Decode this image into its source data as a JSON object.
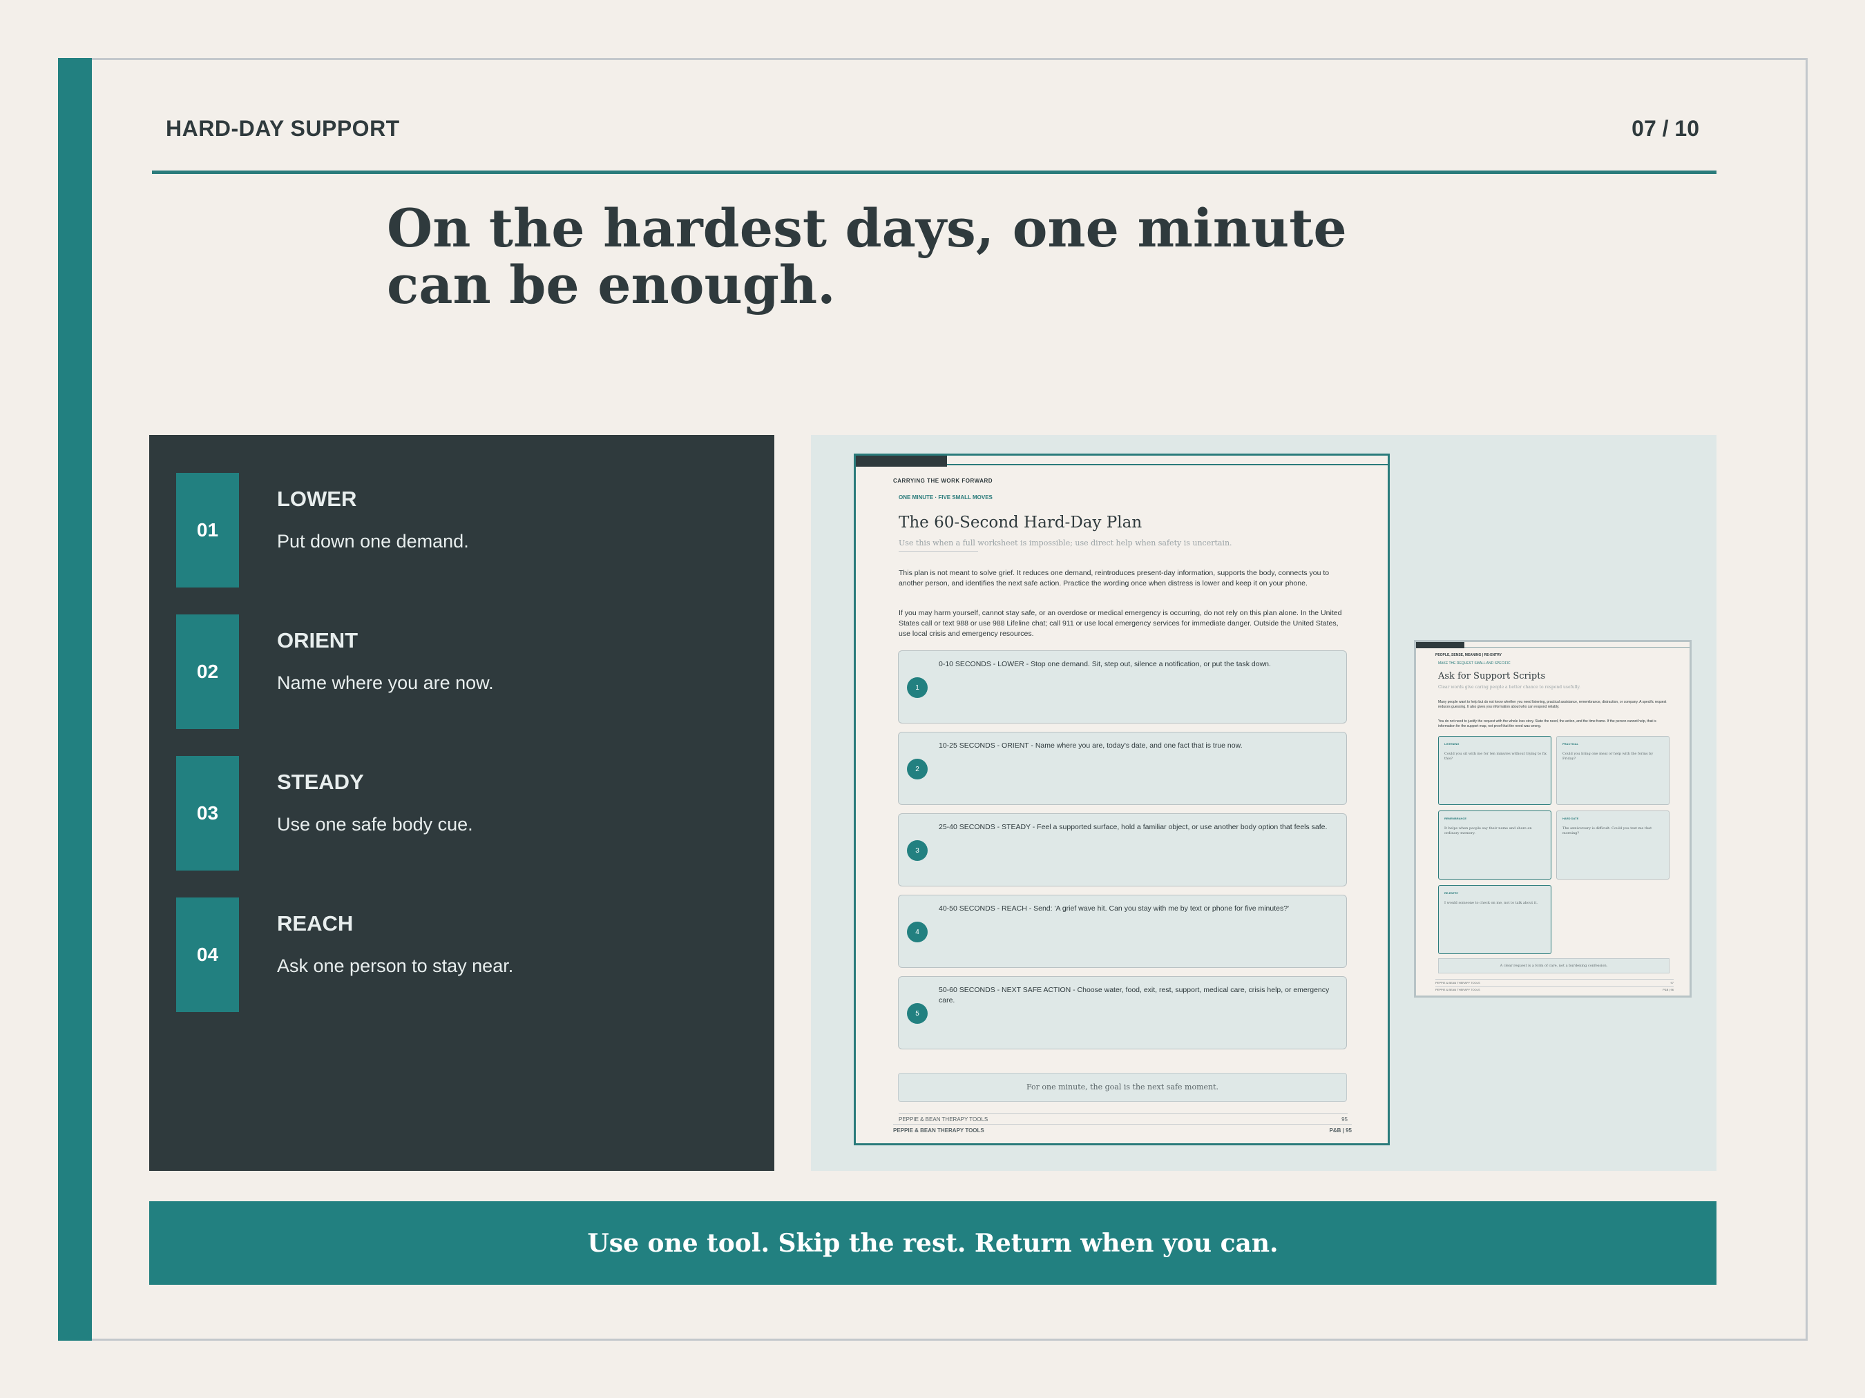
{
  "header": {
    "section": "HARD-DAY SUPPORT",
    "page": "07 / 10"
  },
  "headline": "On the hardest days, one minute can be enough.",
  "steps": [
    {
      "num": "01",
      "title": "LOWER",
      "desc": "Put down one demand."
    },
    {
      "num": "02",
      "title": "ORIENT",
      "desc": "Name where you are now."
    },
    {
      "num": "03",
      "title": "STEADY",
      "desc": "Use one safe body cue."
    },
    {
      "num": "04",
      "title": "REACH",
      "desc": "Ask one person to stay near."
    }
  ],
  "worksheet": {
    "kicker": "CARRYING THE WORK FORWARD",
    "eyebrow": "ONE MINUTE · FIVE SMALL MOVES",
    "title": "The 60-Second Hard-Day Plan",
    "subtitle": "Use this when a full worksheet is impossible; use direct help when safety is uncertain.",
    "para1": "This plan is not meant to solve grief. It reduces one demand, reintroduces present-day information, supports the body, connects you to another person, and identifies the next safe action. Practice the wording once when distress is lower and keep it on your phone.",
    "para2": "If you may harm yourself, cannot stay safe, or an overdose or medical emergency is occurring, do not rely on this plan alone. In the United States call or text 988 or use 988 Lifeline chat; call 911 or use local emergency services for immediate danger. Outside the United States, use local crisis and emergency resources.",
    "moves": [
      {
        "n": "1",
        "text": "0-10 SECONDS - LOWER - Stop one demand. Sit, step out, silence a notification, or put the task down."
      },
      {
        "n": "2",
        "text": "10-25 SECONDS - ORIENT - Name where you are, today's date, and one fact that is true now."
      },
      {
        "n": "3",
        "text": "25-40 SECONDS - STEADY - Feel a supported surface, hold a familiar object, or use another body option that feels safe."
      },
      {
        "n": "4",
        "text": "40-50 SECONDS - REACH - Send: 'A grief wave hit. Can you stay with me by text or phone for five minutes?'"
      },
      {
        "n": "5",
        "text": "50-60 SECONDS - NEXT SAFE ACTION - Choose water, food, exit, rest, support, medical care, crisis help, or emergency care."
      }
    ],
    "callout": "For one minute, the goal is the next safe moment.",
    "footer_brand": "PEPPIE & BEAN THERAPY TOOLS",
    "footer_page": "95",
    "footer_brand2": "PEPPIE & BEAN THERAPY TOOLS",
    "footer_page2": "P&B | 95"
  },
  "mini_page": {
    "kicker": "PEOPLE, SENSE, MEANING | RE-ENTRY",
    "eyebrow": "MAKE THE REQUEST SMALL AND SPECIFIC",
    "title": "Ask for Support Scripts",
    "subtitle": "Clear words give caring people a better chance to respond usefully.",
    "para1": "Many people want to help but do not know whether you need listening, practical assistance, remembrance, distraction, or company. A specific request reduces guessing. It also gives you information about who can respond reliably.",
    "para2": "You do not need to justify the request with the whole loss story. State the need, the action, and the time frame. If the person cannot help, that is information for the support map, not proof that the need was wrong.",
    "cards": [
      {
        "label": "LISTENING",
        "text": "Could you sit with me for ten minutes without trying to fix this?"
      },
      {
        "label": "PRACTICAL",
        "text": "Could you bring one meal or help with the forms by Friday?"
      },
      {
        "label": "REMEMBRANCE",
        "text": "It helps when people say their name and share an ordinary memory."
      },
      {
        "label": "HARD DATE",
        "text": "The anniversary is difficult. Could you text me that morning?"
      },
      {
        "label": "RE-ENTRY",
        "text": "I would someone to check on me, not to talk about it."
      }
    ],
    "callout": "A clear request is a form of care, not a burdening confession.",
    "footer_brand": "PEPPIE & BEAN THERAPY TOOLS",
    "footer_page": "97",
    "footer_brand2": "PEPPIE & BEAN THERAPY TOOLS",
    "footer_page2": "P&B | 96"
  },
  "banner": "Use one tool. Skip the rest. Return when you can.",
  "colors": {
    "teal": "#228080",
    "dark": "#2f3a3d",
    "background": "#f3efea",
    "panel_light": "#dfe8e7"
  }
}
